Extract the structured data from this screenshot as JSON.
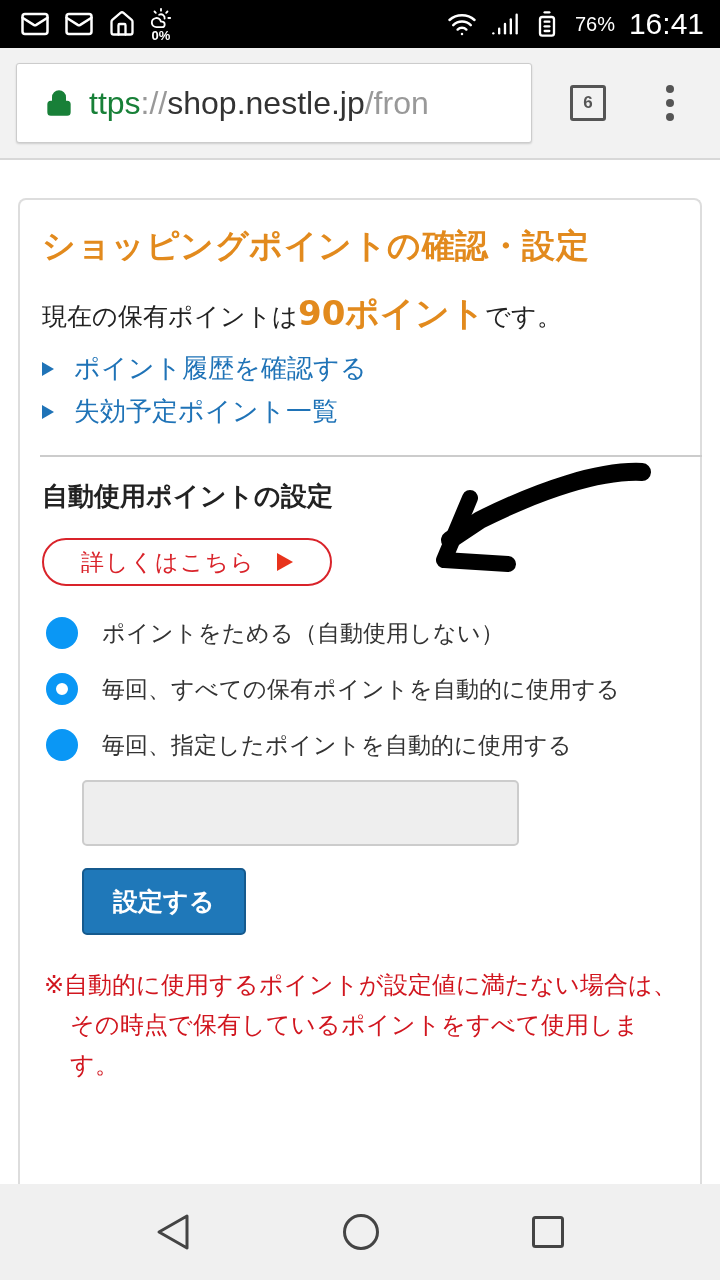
{
  "status_bar": {
    "weather_reading": "0%",
    "battery": "76%",
    "time": "16:41"
  },
  "browser": {
    "url": {
      "scheme": "ttps",
      "separator": "://",
      "host": "shop.nestle.jp",
      "path": "/fron"
    },
    "tab_count": "6"
  },
  "card": {
    "title": "ショッピングポイントの確認・設定",
    "points_text": "現在の保有ポイントは**90ポイント**です。",
    "links": [
      "ポイント履歴を確認する",
      "失効予定ポイント一覧"
    ],
    "section_title": "自動使用ポイントの設定",
    "details_button": "詳しくはこちら",
    "options": [
      {
        "label": "ポイントをためる（自動使用しない）",
        "selected": false
      },
      {
        "label": "毎回、すべての保有ポイントを自動的に使用する",
        "selected": true
      },
      {
        "label": "毎回、指定したポイントを自動的に使用する",
        "selected": false
      }
    ],
    "submit_button": "設定する",
    "note": "※自動的に使用するポイントが設定値に満たない場合は、その時点で保有しているポイントをすべて使用します。"
  }
}
